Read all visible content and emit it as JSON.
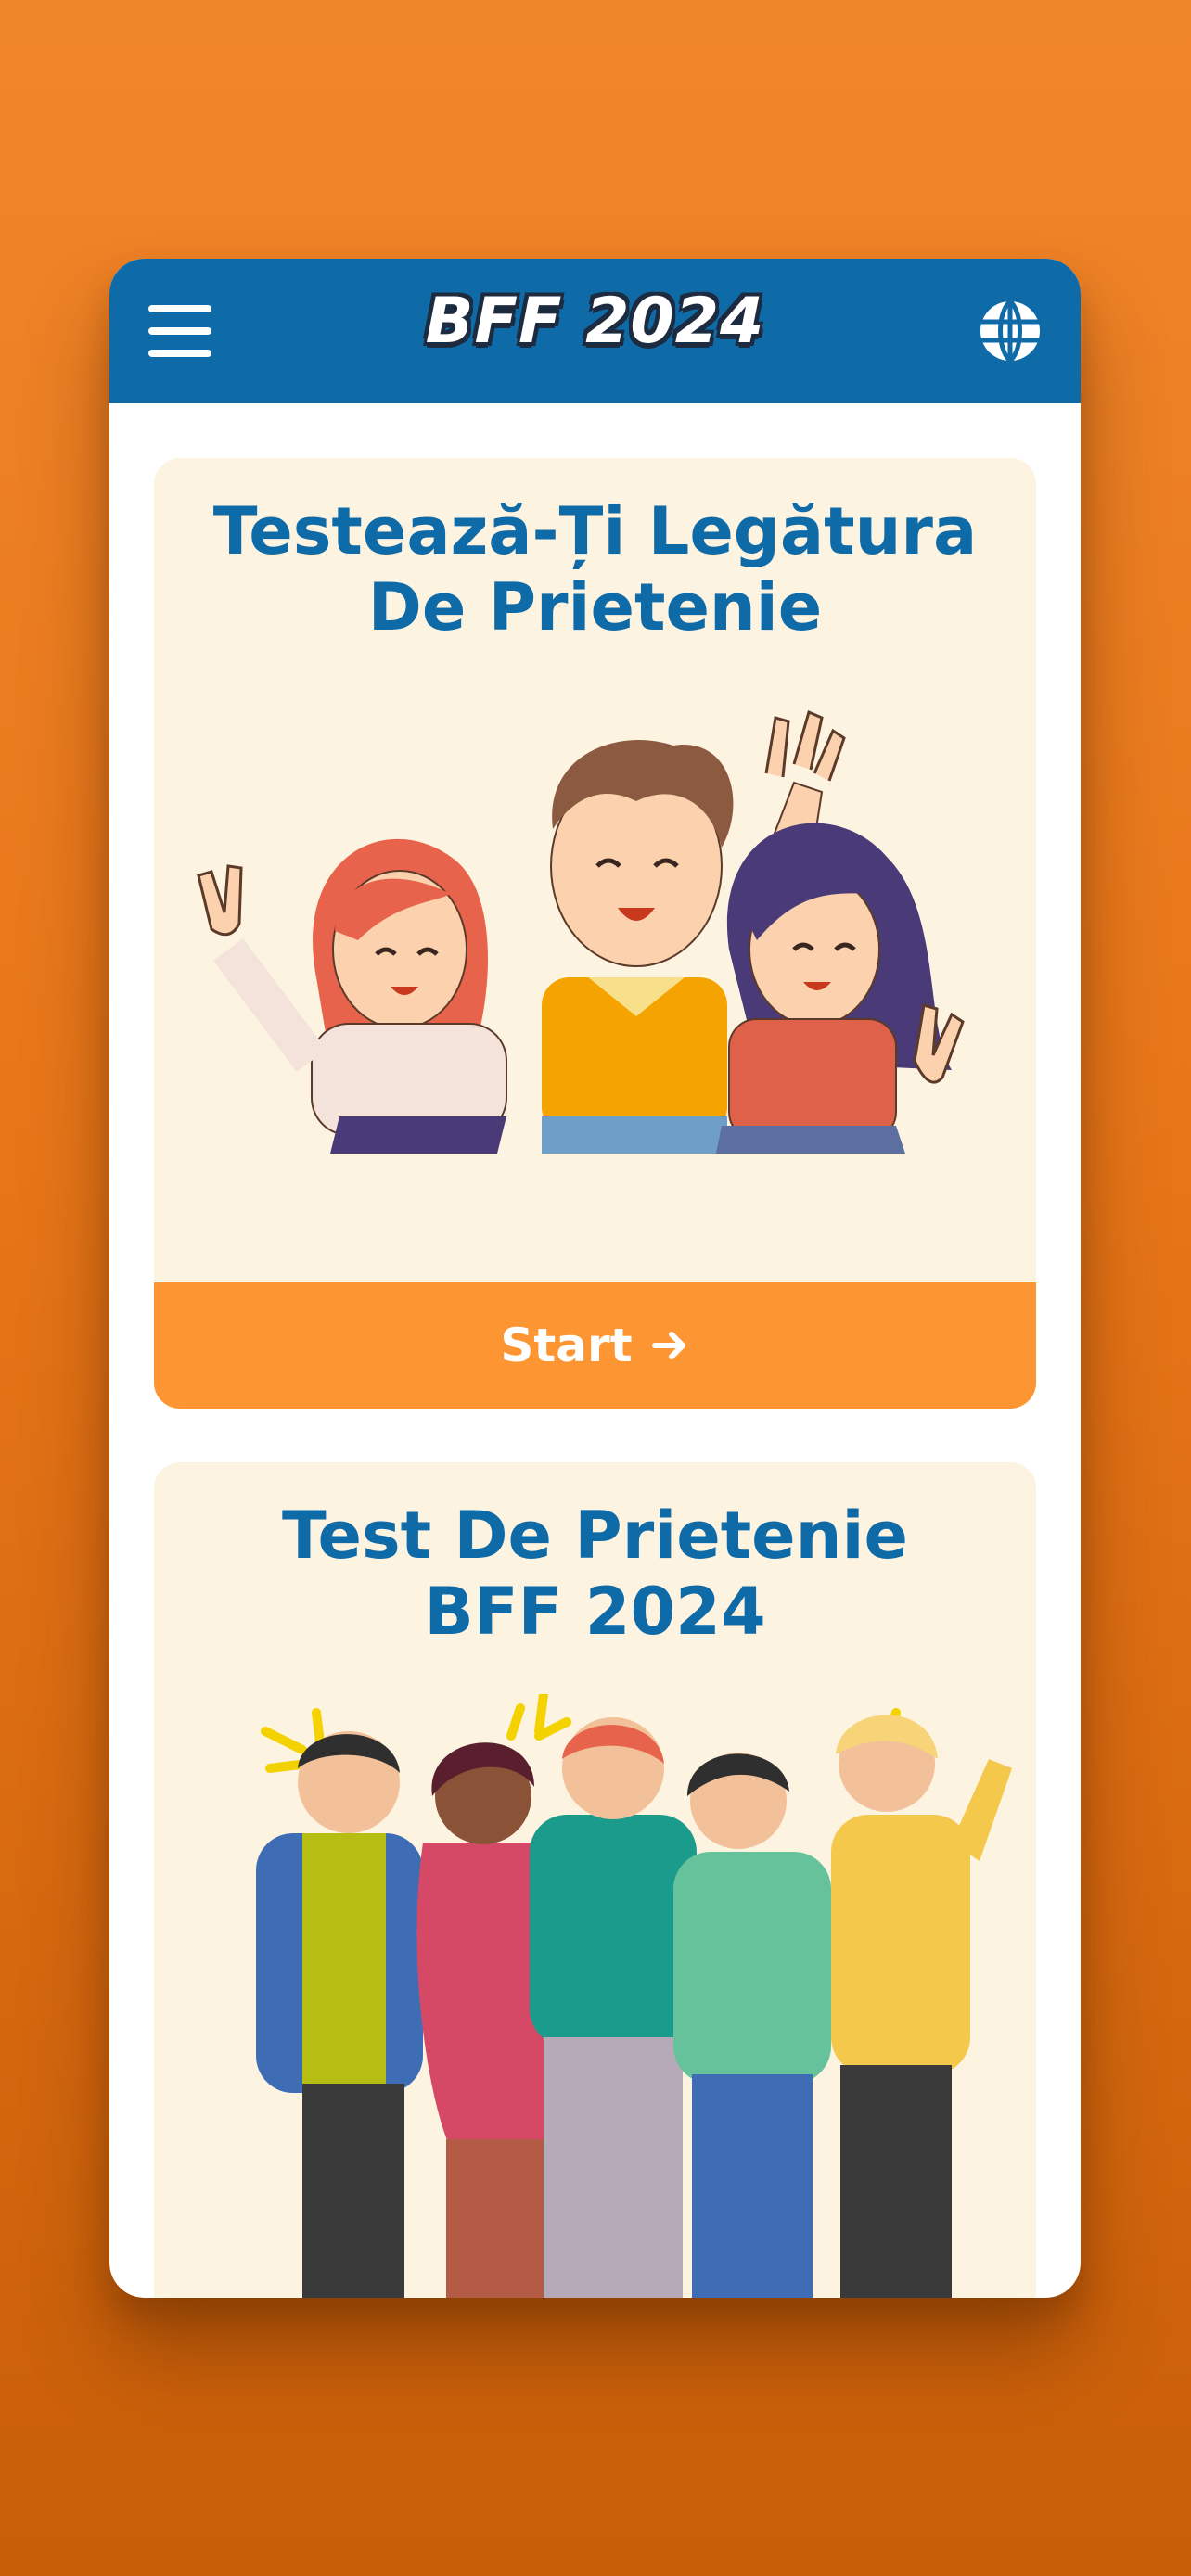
{
  "app": {
    "title": "BFF 2024"
  },
  "header": {
    "menu_icon": "hamburger-menu-icon",
    "language_icon": "globe-icon"
  },
  "cards": [
    {
      "title_line1": "Testează-Ți Legătura",
      "title_line2": "De Prietenie",
      "illustration": "three-friends-waving",
      "button_label": "Start",
      "button_icon": "arrow-right-icon"
    },
    {
      "title_line1": "Test De Prietenie",
      "title_line2": "BFF 2024",
      "illustration": "group-of-five-friends"
    }
  ],
  "colors": {
    "background": "#e87618",
    "header": "#0f6aa8",
    "card": "#fdf3e1",
    "accent_button": "#fc9532",
    "title": "#0f6aa8"
  }
}
